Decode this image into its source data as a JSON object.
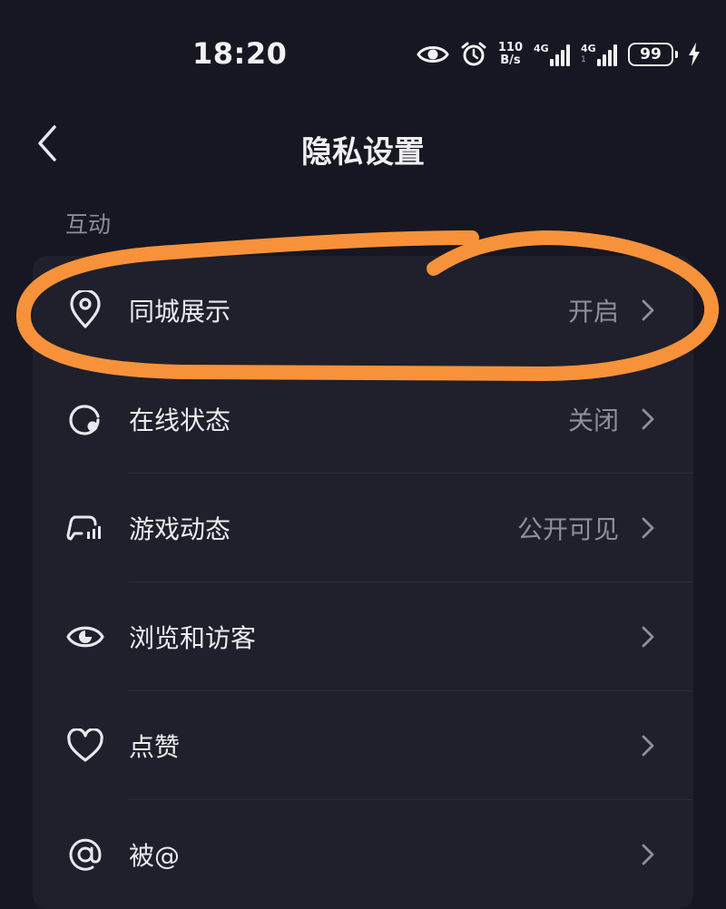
{
  "status_bar": {
    "time": "18:20",
    "net_speed_value": "110",
    "net_speed_unit": "B/s",
    "sim1_label": "4G",
    "sim2_label": "4G",
    "sim2_sub": "1",
    "battery_level": "99",
    "icons": [
      "eye-icon",
      "alarm-icon",
      "signal-icon",
      "battery-icon",
      "charging-bolt-icon"
    ]
  },
  "header": {
    "title": "隐私设置",
    "back_icon": "chevron-left-icon"
  },
  "section": {
    "title": "互动"
  },
  "items": [
    {
      "icon": "location-pin-icon",
      "label": "同城展示",
      "value": "开启"
    },
    {
      "icon": "online-status-icon",
      "label": "在线状态",
      "value": "关闭"
    },
    {
      "icon": "game-controller-icon",
      "label": "游戏动态",
      "value": "公开可见"
    },
    {
      "icon": "eye-icon",
      "label": "浏览和访客",
      "value": ""
    },
    {
      "icon": "heart-icon",
      "label": "点赞",
      "value": ""
    },
    {
      "icon": "at-sign-icon",
      "label": "被@",
      "value": ""
    }
  ],
  "colors": {
    "background": "#161722",
    "card": "#1f202b",
    "annotation": "#f7923a",
    "secondary_text": "#8e8f99"
  }
}
